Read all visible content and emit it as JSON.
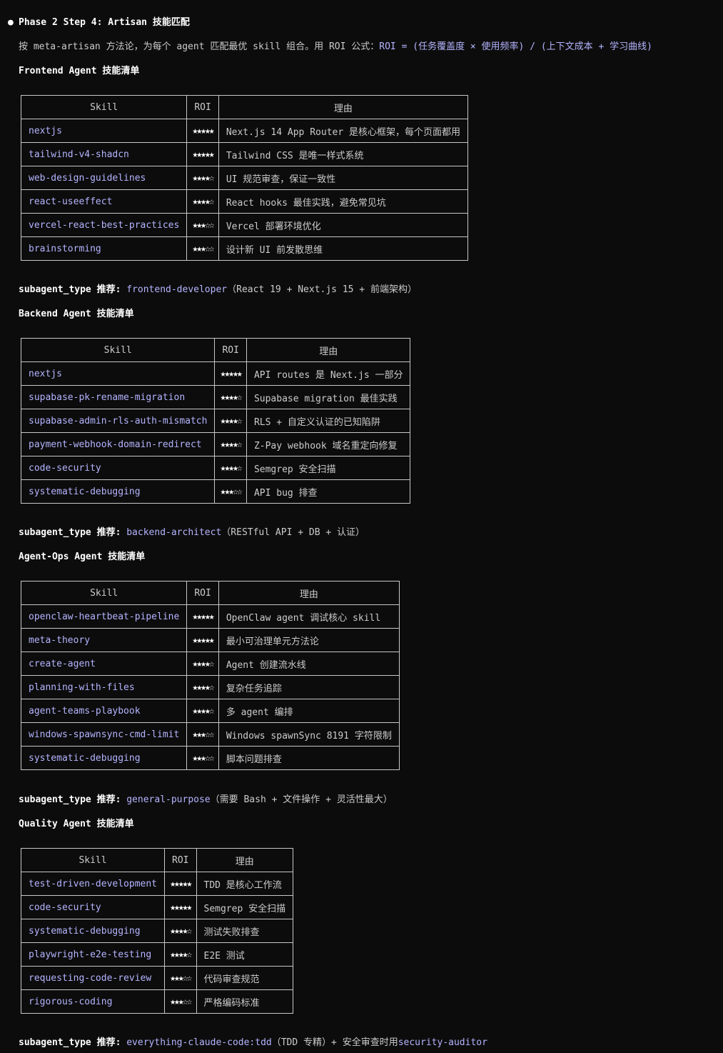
{
  "header": {
    "bullet": "●",
    "title": "Phase 2 Step 4: Artisan 技能匹配"
  },
  "intro": {
    "text": "按 meta-artisan 方法论，为每个 agent 匹配最优 skill 组合。用 ROI 公式：",
    "formula": "ROI = (任务覆盖度 × 使用频率) / (上下文成本 + 学习曲线)"
  },
  "columns": {
    "skill": "Skill",
    "roi": "ROI",
    "reason": "理由"
  },
  "stars": {
    "full": "★",
    "empty": "☆"
  },
  "sections": [
    {
      "heading": "Frontend Agent 技能清单",
      "rows": [
        {
          "skill": "nextjs",
          "roi": 5,
          "reason": "Next.js 14 App Router 是核心框架，每个页面都用"
        },
        {
          "skill": "tailwind-v4-shadcn",
          "roi": 5,
          "reason": "Tailwind CSS 是唯一样式系统"
        },
        {
          "skill": "web-design-guidelines",
          "roi": 4,
          "reason": "UI 规范审查，保证一致性"
        },
        {
          "skill": "react-useeffect",
          "roi": 4,
          "reason": "React hooks 最佳实践，避免常见坑"
        },
        {
          "skill": "vercel-react-best-practices",
          "roi": 3,
          "reason": "Vercel 部署环境优化"
        },
        {
          "skill": "brainstorming",
          "roi": 3,
          "reason": "设计新 UI 前发散思维"
        }
      ],
      "recommend_label": "subagent_type 推荐",
      "recommend_value": "frontend-developer",
      "recommend_note": "（React 19 + Next.js 15 + 前端架构）"
    },
    {
      "heading": "Backend Agent 技能清单",
      "rows": [
        {
          "skill": "nextjs",
          "roi": 5,
          "reason": "API routes 是 Next.js 一部分"
        },
        {
          "skill": "supabase-pk-rename-migration",
          "roi": 4,
          "reason": "Supabase migration 最佳实践"
        },
        {
          "skill": "supabase-admin-rls-auth-mismatch",
          "roi": 4,
          "reason": "RLS + 自定义认证的已知陷阱"
        },
        {
          "skill": "payment-webhook-domain-redirect",
          "roi": 4,
          "reason": "Z-Pay webhook 域名重定向修复"
        },
        {
          "skill": "code-security",
          "roi": 4,
          "reason": "Semgrep 安全扫描"
        },
        {
          "skill": "systematic-debugging",
          "roi": 3,
          "reason": "API bug 排查"
        }
      ],
      "recommend_label": "subagent_type 推荐",
      "recommend_value": "backend-architect",
      "recommend_note": "（RESTful API + DB + 认证）"
    },
    {
      "heading": "Agent-Ops Agent 技能清单",
      "rows": [
        {
          "skill": "openclaw-heartbeat-pipeline",
          "roi": 5,
          "reason": "OpenClaw agent 调试核心 skill"
        },
        {
          "skill": "meta-theory",
          "roi": 5,
          "reason": "最小可治理单元方法论"
        },
        {
          "skill": "create-agent",
          "roi": 4,
          "reason": "Agent 创建流水线"
        },
        {
          "skill": "planning-with-files",
          "roi": 4,
          "reason": "复杂任务追踪"
        },
        {
          "skill": "agent-teams-playbook",
          "roi": 4,
          "reason": "多 agent 编排"
        },
        {
          "skill": "windows-spawnsync-cmd-limit",
          "roi": 3,
          "reason": "Windows spawnSync 8191 字符限制"
        },
        {
          "skill": "systematic-debugging",
          "roi": 3,
          "reason": "脚本问题排查"
        }
      ],
      "recommend_label": "subagent_type 推荐",
      "recommend_value": "general-purpose",
      "recommend_note": "（需要 Bash + 文件操作 + 灵活性最大）"
    },
    {
      "heading": "Quality Agent 技能清单",
      "rows": [
        {
          "skill": "test-driven-development",
          "roi": 5,
          "reason": "TDD 是核心工作流"
        },
        {
          "skill": "code-security",
          "roi": 5,
          "reason": "Semgrep 安全扫描"
        },
        {
          "skill": "systematic-debugging",
          "roi": 4,
          "reason": "测试失败排查"
        },
        {
          "skill": "playwright-e2e-testing",
          "roi": 4,
          "reason": "E2E 测试"
        },
        {
          "skill": "requesting-code-review",
          "roi": 3,
          "reason": "代码审查规范"
        },
        {
          "skill": "rigorous-coding",
          "roi": 3,
          "reason": "严格编码标准"
        }
      ],
      "recommend_label": "subagent_type 推荐",
      "recommend_value": "everything-claude-code:tdd",
      "recommend_note": "（TDD 专精）+ 安全审查时用",
      "recommend_extra": "security-auditor"
    }
  ]
}
